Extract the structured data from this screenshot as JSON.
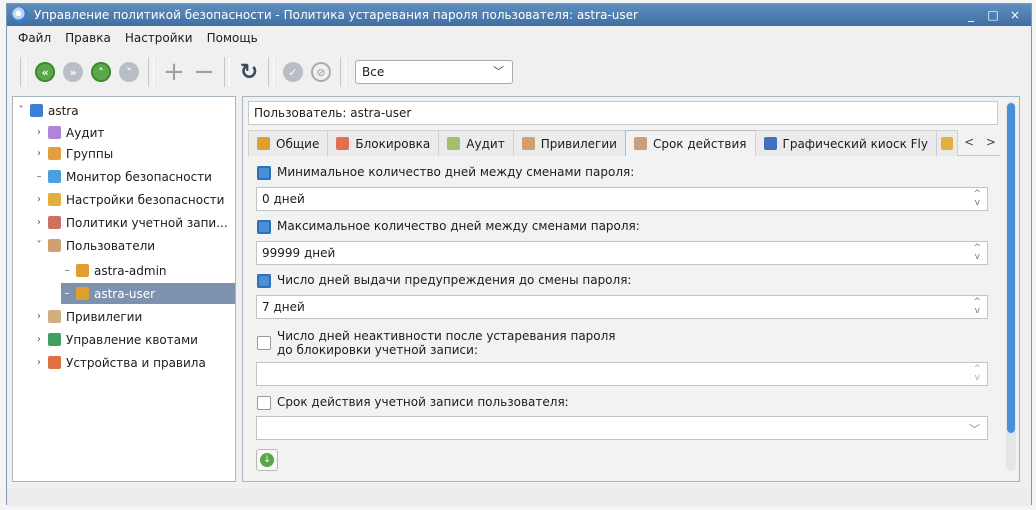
{
  "window": {
    "title": "Управление политикой безопасности - Политика устаревания пароля пользователя: astra-user",
    "controls": [
      "_",
      "□",
      "×"
    ]
  },
  "menu": [
    "Файл",
    "Правка",
    "Настройки",
    "Помощь"
  ],
  "toolbar": {
    "filter_value": "Все",
    "icons": [
      "back-icon",
      "forward-icon",
      "up-icon",
      "down-icon",
      "add-icon",
      "remove-icon",
      "refresh-icon",
      "apply-icon",
      "cancel-icon"
    ]
  },
  "tree": {
    "root": "astra",
    "items": [
      {
        "label": "Аудит"
      },
      {
        "label": "Группы"
      },
      {
        "label": "Монитор безопасности"
      },
      {
        "label": "Настройки безопасности"
      },
      {
        "label": "Политики учетной запи..."
      },
      {
        "label": "Пользователи"
      },
      {
        "label": "astra-admin"
      },
      {
        "label": "astra-user"
      },
      {
        "label": "Привилегии"
      },
      {
        "label": "Управление квотами"
      },
      {
        "label": "Устройства и правила"
      }
    ]
  },
  "user_field": "Пользователь: astra-user",
  "tabs": [
    "Общие",
    "Блокировка",
    "Аудит",
    "Привилегии",
    "Срок действия",
    "Графический киоск Fly"
  ],
  "tab_scroll": "< >",
  "fields": {
    "min_days_label": "Минимальное количество дней между сменами пароля:",
    "min_days_value": "0 дней",
    "max_days_label": "Максимальное количество дней между сменами пароля:",
    "max_days_value": "99999 дней",
    "warn_days_label": "Число дней выдачи предупреждения до смены пароля:",
    "warn_days_value": "7 дней",
    "inactive_label_line1": "Число дней неактивности после устаревания пароля",
    "inactive_label_line2": "до блокировки учетной записи:",
    "inactive_value": "",
    "expiry_label": "Срок действия учетной записи пользователя:",
    "expiry_value": ""
  },
  "spin_arrows": {
    "up": "^",
    "down": "v"
  },
  "dropdown_chevron": "﹀",
  "colors": {
    "accent": "#4a90d9",
    "selection": "#7d93ad",
    "titlebar": "#4f7fb2"
  }
}
